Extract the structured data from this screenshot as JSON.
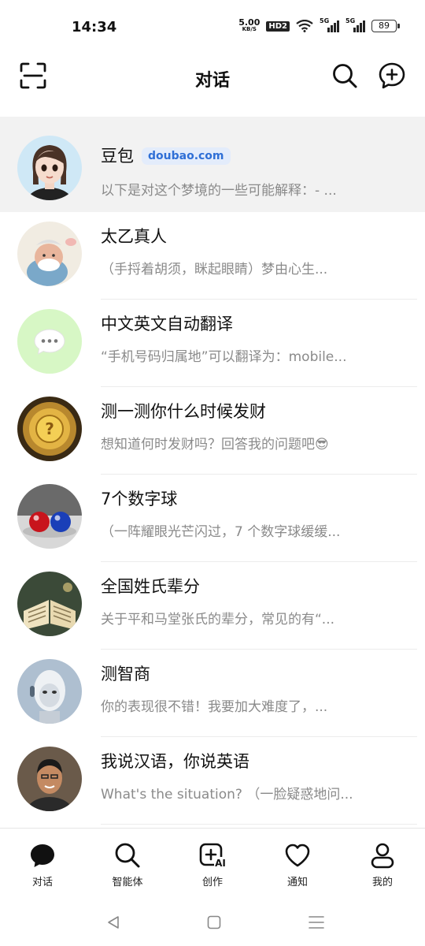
{
  "status_bar": {
    "time": "14:34",
    "net_speed_value": "5.00",
    "net_speed_unit": "KB/S",
    "hd_label": "HD2",
    "sim1_label": "5G",
    "sim2_label": "5G",
    "battery": "89"
  },
  "header": {
    "title": "对话",
    "left_icon": "scan-icon",
    "right_icons": [
      "search-icon",
      "new-chat-icon"
    ]
  },
  "chats": [
    {
      "name": "豆包",
      "badge": "doubao.com",
      "preview": "以下是对这个梦境的一些可能解释：- ..."
    },
    {
      "name": "太乙真人",
      "preview": "（手捋着胡须，眯起眼睛）梦由心生..."
    },
    {
      "name": "中文英文自动翻译",
      "preview": "“手机号码归属地”可以翻译为：mobile..."
    },
    {
      "name": "测一测你什么时候发财",
      "preview": "想知道何时发财吗？回答我的问题吧😎"
    },
    {
      "name": "7个数字球",
      "preview": "（一阵耀眼光芒闪过，7 个数字球缓缓..."
    },
    {
      "name": "全国姓氏辈分",
      "preview": "关于平和马堂张氏的辈分，常见的有“..."
    },
    {
      "name": "测智商",
      "preview": "你的表现很不错！我要加大难度了，..."
    },
    {
      "name": "我说汉语，你说英语",
      "preview": "What's the situation? （一脸疑惑地问..."
    }
  ],
  "tabs": [
    {
      "label": "对话",
      "icon": "chat-bubble-icon",
      "active": true
    },
    {
      "label": "智能体",
      "icon": "search-icon"
    },
    {
      "label": "创作",
      "icon": "ai-create-icon"
    },
    {
      "label": "通知",
      "icon": "heart-icon"
    },
    {
      "label": "我的",
      "icon": "person-icon"
    }
  ],
  "nav": [
    "back-icon",
    "home-icon",
    "recents-icon"
  ],
  "colors": {
    "accent": "#2f6fd6",
    "preview_text": "#8a8a8a",
    "pinned_bg": "#f2f2f2"
  }
}
